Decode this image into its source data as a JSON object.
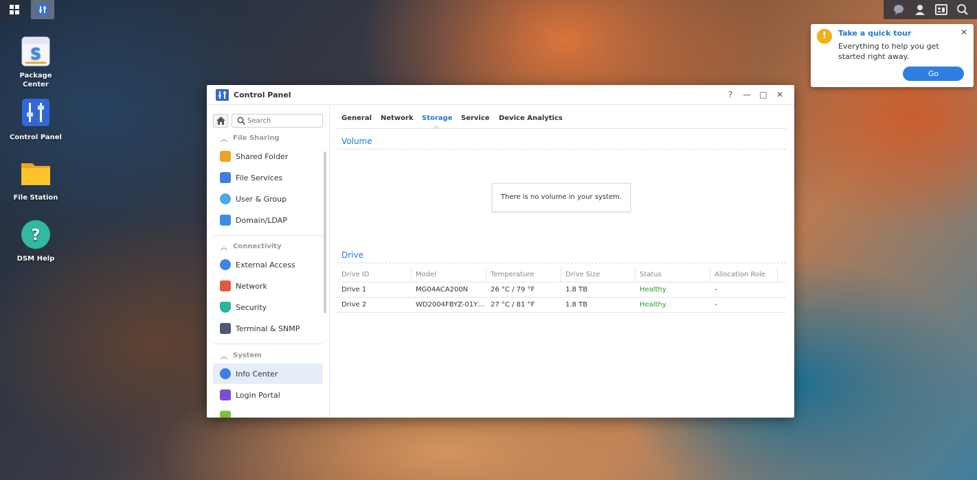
{
  "taskbar": {
    "main_menu_icon": "grid-icon",
    "active_app_icon": "control-panel-icon",
    "right_icons": [
      "chat-icon",
      "user-icon",
      "widgets-icon",
      "search-icon"
    ]
  },
  "desktop": {
    "icons": [
      {
        "label_line1": "Package",
        "label_line2": "Center"
      },
      {
        "label_line1": "Control Panel",
        "label_line2": ""
      },
      {
        "label_line1": "File Station",
        "label_line2": ""
      },
      {
        "label_line1": "DSM Help",
        "label_line2": ""
      }
    ]
  },
  "tour": {
    "badge": "!",
    "title": "Take a quick tour",
    "text": "Everything to help you get started right away.",
    "go_label": "Go",
    "close": "✕"
  },
  "window": {
    "title": "Control Panel",
    "help": "?",
    "minimize": "—",
    "maximize": "□",
    "close": "✕"
  },
  "sidebar": {
    "search_placeholder": "Search",
    "sections": [
      {
        "label": "File Sharing",
        "items": [
          "Shared Folder",
          "File Services",
          "User & Group",
          "Domain/LDAP"
        ]
      },
      {
        "label": "Connectivity",
        "items": [
          "External Access",
          "Network",
          "Security",
          "Terminal & SNMP"
        ]
      },
      {
        "label": "System",
        "items": [
          "Info Center",
          "Login Portal"
        ]
      }
    ],
    "selected_item": "Info Center"
  },
  "tabs": [
    "General",
    "Network",
    "Storage",
    "Service",
    "Device Analytics"
  ],
  "active_tab": "Storage",
  "volume": {
    "title": "Volume",
    "empty_message": "There is no volume in your system."
  },
  "drive": {
    "title": "Drive",
    "columns": [
      "Drive ID",
      "Model",
      "Temperature",
      "Drive Size",
      "Status",
      "Allocation Role"
    ],
    "rows": [
      [
        "Drive 1",
        "MG04ACA200N",
        "26 °C / 79 °F",
        "1.8 TB",
        "Healthy",
        "-"
      ],
      [
        "Drive 2",
        "WD2004FBYZ-01Y…",
        "27 °C / 81 °F",
        "1.8 TB",
        "Healthy",
        "-"
      ]
    ],
    "status_color": "#2a9b1e"
  },
  "colors": {
    "accent": "#1f78d1",
    "tour_badge": "#f2b01e",
    "go_button": "#2f7fe0"
  }
}
